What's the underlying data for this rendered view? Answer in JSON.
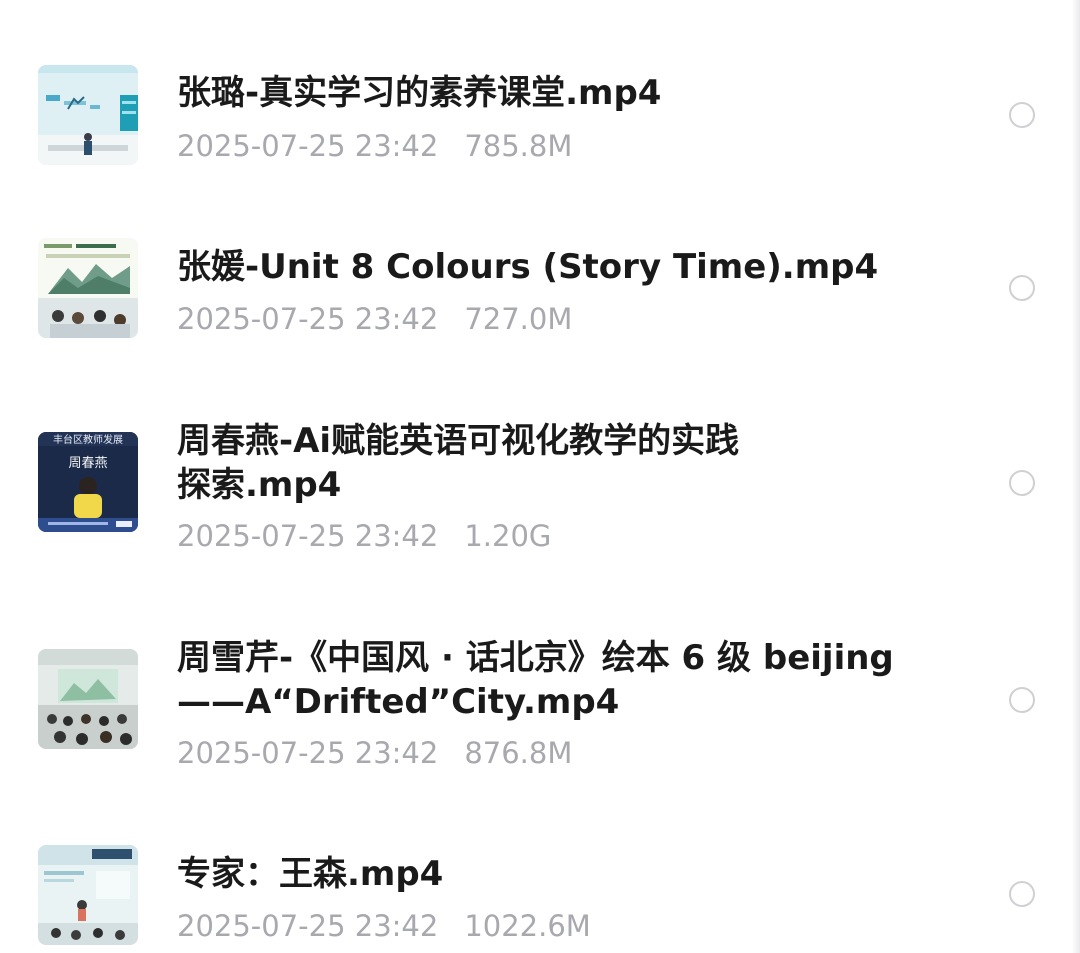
{
  "files": [
    {
      "name": "张璐-真实学习的素养课堂.mp4",
      "name_line2": "",
      "date": "2025-07-25 23:42",
      "size": "785.8M",
      "thumb_icon": "video-thumbnail-icon"
    },
    {
      "name": "张媛-Unit 8 Colours (Story Time).mp4",
      "name_line2": "",
      "date": "2025-07-25 23:42",
      "size": "727.0M",
      "thumb_icon": "video-thumbnail-icon"
    },
    {
      "name": "周春燕-Ai赋能英语可视化教学的实践",
      "name_line2": "探索.mp4",
      "date": "2025-07-25 23:42",
      "size": "1.20G",
      "thumb_icon": "video-thumbnail-icon",
      "thumb_text": {
        "top": "丰台区教师发展",
        "name": "周春燕"
      }
    },
    {
      "name": "周雪芹-《中国风 · 话北京》绘本 6 级 beijing",
      "name_line2": "——A“Drifted”City.mp4",
      "date": "2025-07-25 23:42",
      "size": "876.8M",
      "thumb_icon": "video-thumbnail-icon"
    },
    {
      "name": "专家：王森.mp4",
      "name_line2": "",
      "date": "2025-07-25 23:42",
      "size": "1022.6M",
      "thumb_icon": "video-thumbnail-icon"
    }
  ],
  "colors": {
    "title": "#1a1a1a",
    "meta": "#a8a9ae",
    "radio_border": "#cfd0d4",
    "background": "#ffffff"
  }
}
